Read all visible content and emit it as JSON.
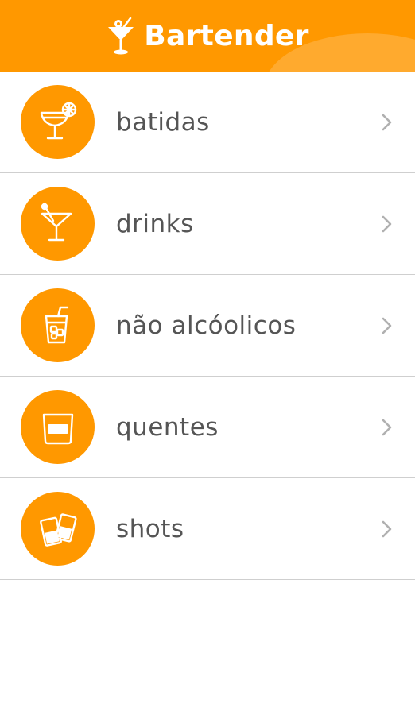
{
  "header": {
    "title": "Bartender",
    "icon": "cocktail-glass-icon",
    "background_color": "#ff9800"
  },
  "menu": {
    "items": [
      {
        "label": "batidas",
        "icon": "margarita-glass-icon"
      },
      {
        "label": "drinks",
        "icon": "martini-glass-icon"
      },
      {
        "label": "não alcóolicos",
        "icon": "soda-cup-icon"
      },
      {
        "label": "quentes",
        "icon": "hot-cup-icon"
      },
      {
        "label": "shots",
        "icon": "shot-glasses-icon"
      }
    ],
    "accent_color": "#ff9800",
    "label_color": "#555555",
    "chevron_color": "#b0b0b0",
    "divider_color": "#cfcfcf"
  }
}
